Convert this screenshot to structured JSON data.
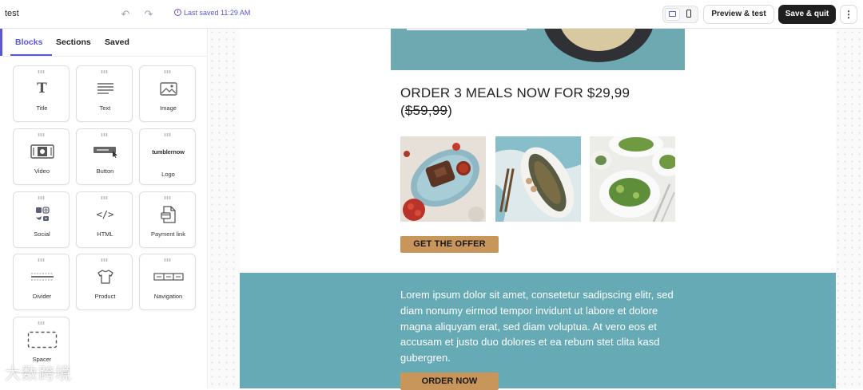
{
  "topbar": {
    "doc_title": "test",
    "undo_icon": "undo-icon",
    "redo_icon": "redo-icon",
    "saved_text": "Last saved 11:29 AM",
    "preview_label": "Preview & test",
    "save_label": "Save & quit",
    "more_label": "⋮"
  },
  "panel": {
    "tabs": [
      {
        "label": "Blocks",
        "active": true
      },
      {
        "label": "Sections",
        "active": false
      },
      {
        "label": "Saved",
        "active": false
      }
    ],
    "blocks": [
      {
        "label": "Title",
        "icon": "title-icon"
      },
      {
        "label": "Text",
        "icon": "text-icon"
      },
      {
        "label": "Image",
        "icon": "image-icon"
      },
      {
        "label": "Video",
        "icon": "video-icon"
      },
      {
        "label": "Button",
        "icon": "button-icon"
      },
      {
        "label": "Logo",
        "icon": "logo-icon",
        "logo_text": "tumblernow"
      },
      {
        "label": "Social",
        "icon": "social-icon"
      },
      {
        "label": "HTML",
        "icon": "code-icon"
      },
      {
        "label": "Payment link",
        "icon": "payment-link-icon"
      },
      {
        "label": "Divider",
        "icon": "divider-icon"
      },
      {
        "label": "Product",
        "icon": "product-icon"
      },
      {
        "label": "Navigation",
        "icon": "navigation-icon"
      },
      {
        "label": "Spacer",
        "icon": "spacer-icon"
      }
    ]
  },
  "email": {
    "headline_line1": "ORDER 3 MEALS NOW FOR $29,99",
    "headline_line2_strike": "$59,99",
    "cta1": "GET THE OFFER",
    "lorem": "Lorem ipsum dolor sit amet, consetetur sadipscing elitr, sed diam nonumy eirmod tempor invidunt ut labore et dolore magna aliquyam erat, sed diam voluptua. At vero eos et accusam et justo duo dolores et ea rebum stet clita kasd gubergren.",
    "cta2": "ORDER NOW"
  },
  "watermark": "大数跨境",
  "colors": {
    "accent": "#5a57d6",
    "teal": "#65aab4",
    "cta": "#c8955b",
    "dark_button": "#1f1f1f"
  }
}
